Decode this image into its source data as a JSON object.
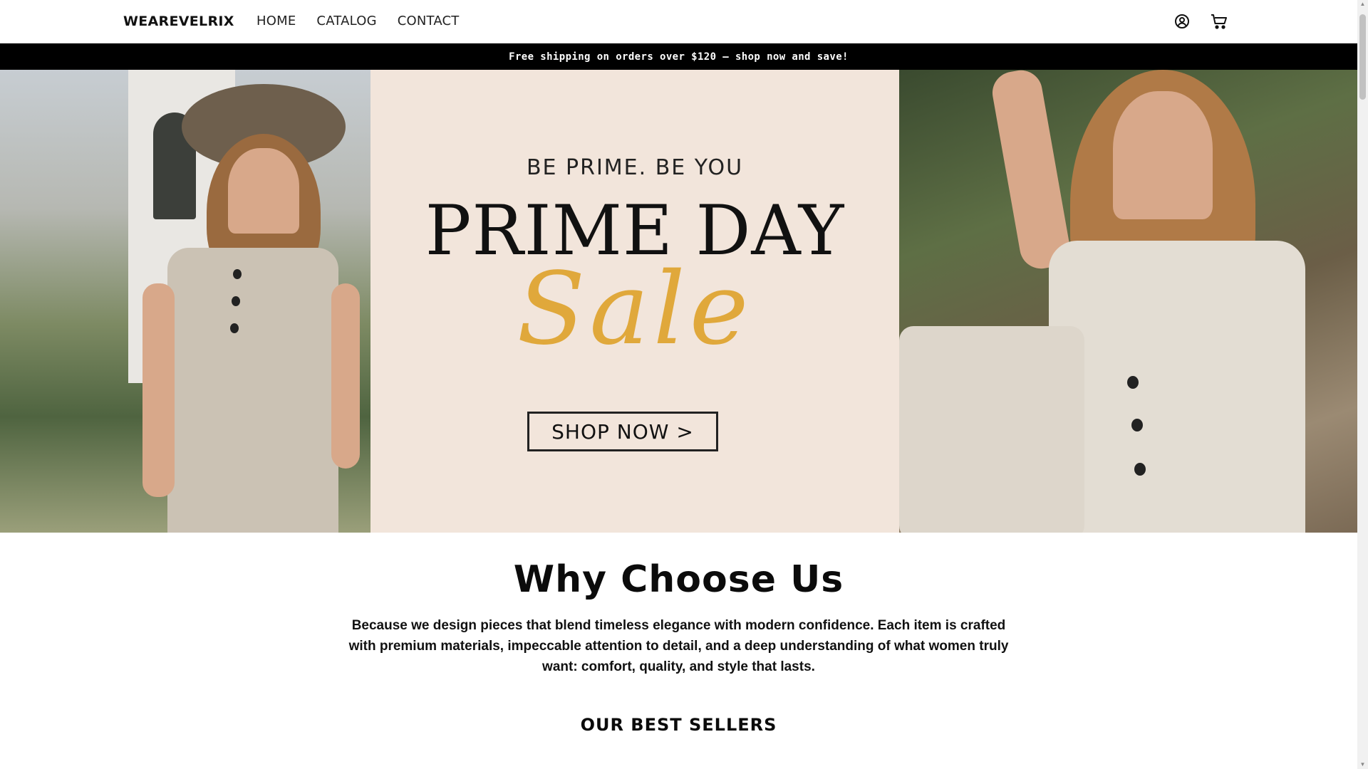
{
  "header": {
    "logo": "WEAREVELRIX",
    "nav": [
      {
        "label": "HOME"
      },
      {
        "label": "CATALOG"
      },
      {
        "label": "CONTACT"
      }
    ],
    "icons": {
      "account": "account-icon",
      "cart": "cart-icon"
    }
  },
  "announcement": {
    "text": "Free shipping on orders over $120 – shop now and save!"
  },
  "hero": {
    "tagline": "BE PRIME. BE YOU",
    "headline": "PRIME DAY",
    "script": "Sale",
    "cta": "SHOP NOW >",
    "colors": {
      "background": "#f2e5db",
      "script": "#e0a83b"
    }
  },
  "why": {
    "title": "Why Choose Us",
    "text": "Because we design pieces that blend timeless elegance with modern confidence. Each item is crafted with premium materials, impeccable attention to detail, and a deep understanding of what women truly want: comfort, quality, and style that lasts."
  },
  "best_sellers": {
    "title": "OUR BEST SELLERS"
  }
}
